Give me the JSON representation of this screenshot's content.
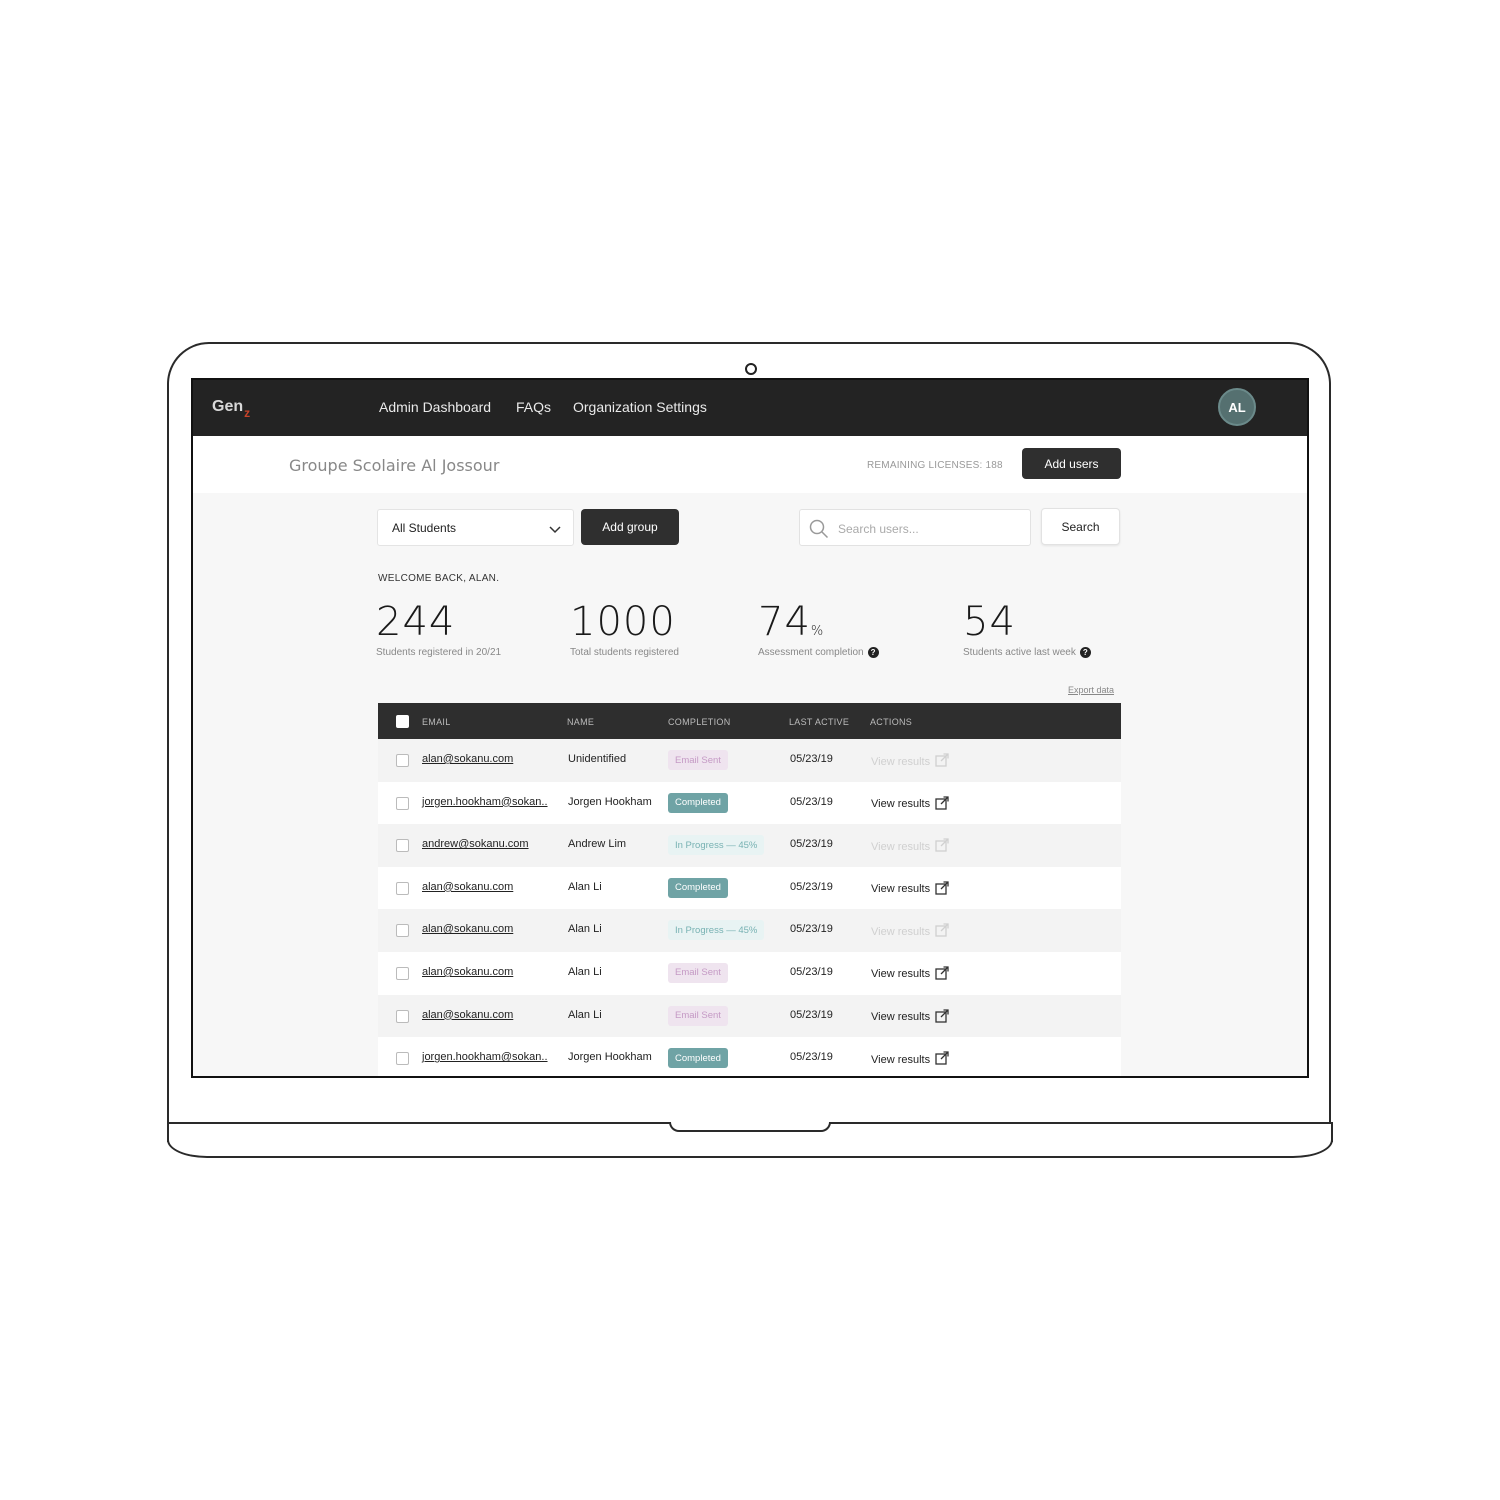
{
  "brand": {
    "name": "Gen",
    "sub": "z"
  },
  "nav": {
    "links": [
      "Admin Dashboard",
      "FAQs",
      "Organization Settings"
    ],
    "avatar_initials": "AL"
  },
  "header": {
    "org_name": "Groupe Scolaire Al Jossour",
    "licenses": "REMAINING LICENSES: 188",
    "add_users_label": "Add users"
  },
  "filters": {
    "group_select": "All Students",
    "add_group_label": "Add group",
    "search_placeholder": "Search users...",
    "search_button": "Search"
  },
  "welcome": "WELCOME BACK, ALAN.",
  "stats": [
    {
      "value": "244",
      "unit": "",
      "label": "Students registered in 20/21",
      "help": false
    },
    {
      "value": "1000",
      "unit": "",
      "label": "Total students registered",
      "help": false
    },
    {
      "value": "74",
      "unit": "%",
      "label": "Assessment completion",
      "help": true
    },
    {
      "value": "54",
      "unit": "",
      "label": "Students active last week",
      "help": true
    }
  ],
  "export_label": "Export data",
  "table": {
    "columns": [
      "EMAIL",
      "NAME",
      "COMPLETION",
      "LAST ACTIVE",
      "ACTIONS"
    ],
    "rows": [
      {
        "email": "alan@sokanu.com",
        "name": "Unidentified",
        "status": "Email Sent",
        "status_type": "sent",
        "last_active": "05/23/19",
        "action": "View results",
        "action_enabled": false
      },
      {
        "email": "jorgen.hookham@sokan..",
        "name": "Jorgen Hookham",
        "status": "Completed",
        "status_type": "done",
        "last_active": "05/23/19",
        "action": "View results",
        "action_enabled": true
      },
      {
        "email": "andrew@sokanu.com",
        "name": "Andrew Lim",
        "status": "In Progress — 45%",
        "status_type": "prog",
        "last_active": "05/23/19",
        "action": "View results",
        "action_enabled": false
      },
      {
        "email": "alan@sokanu.com",
        "name": "Alan Li",
        "status": "Completed",
        "status_type": "done",
        "last_active": "05/23/19",
        "action": "View results",
        "action_enabled": true
      },
      {
        "email": "alan@sokanu.com",
        "name": "Alan Li",
        "status": "In Progress — 45%",
        "status_type": "prog",
        "last_active": "05/23/19",
        "action": "View results",
        "action_enabled": false
      },
      {
        "email": "alan@sokanu.com",
        "name": "Alan Li",
        "status": "Email Sent",
        "status_type": "sent",
        "last_active": "05/23/19",
        "action": "View results",
        "action_enabled": true
      },
      {
        "email": "alan@sokanu.com",
        "name": "Alan Li",
        "status": "Email Sent",
        "status_type": "sent",
        "last_active": "05/23/19",
        "action": "View results",
        "action_enabled": true
      },
      {
        "email": "jorgen.hookham@sokan..",
        "name": "Jorgen Hookham",
        "status": "Completed",
        "status_type": "done",
        "last_active": "05/23/19",
        "action": "View results",
        "action_enabled": true
      }
    ]
  },
  "colors": {
    "nav_bg": "#232323",
    "avatar": "#557070",
    "completed": "#6fa3a5",
    "email_sent": "#efe4ef",
    "in_progress": "#e8f3f3"
  }
}
